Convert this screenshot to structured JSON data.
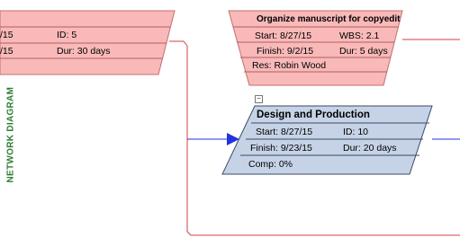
{
  "side_label": "NETWORK DIAGRAM",
  "left_node": {
    "row1_left": "/15",
    "id": "ID:  5",
    "row2_left": "/15",
    "dur": "Dur: 30 days"
  },
  "top_node": {
    "title": "Organize manuscript for copyedit",
    "start": "Start:  8/27/15",
    "wbs": "WBS: 2.1",
    "finish": "Finish: 9/2/15",
    "dur": "Dur: 5 days",
    "res": "Res:   Robin Wood"
  },
  "main_node": {
    "collapse": "−",
    "title": "Design and Production",
    "start": "Start:  8/27/15",
    "id": "ID:   10",
    "finish": "Finish: 9/23/15",
    "dur": "Dur: 20 days",
    "comp": "Comp: 0%"
  },
  "colors": {
    "red_fill": "#f9b9b9",
    "red_stroke": "#c07070",
    "blue_fill": "#c6d3e6",
    "blue_stroke": "#3a4a6a",
    "link_red": "#d04040",
    "link_blue": "#2233dd"
  }
}
